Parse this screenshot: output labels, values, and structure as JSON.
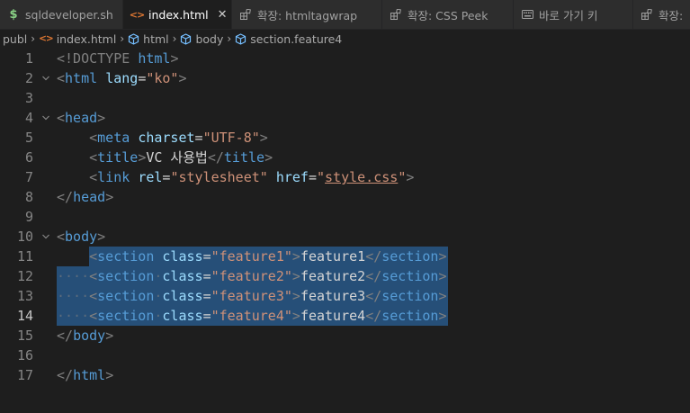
{
  "tabs": [
    {
      "label": "sqldeveloper.sh",
      "icon": "dollar-icon",
      "active": false
    },
    {
      "label": "index.html",
      "icon": "html-file-icon",
      "active": true,
      "close": "✕"
    },
    {
      "label": "확장: htmltagwrap",
      "icon": "extension-icon",
      "active": false
    },
    {
      "label": "확장: CSS Peek",
      "icon": "extension-icon",
      "active": false
    },
    {
      "label": "바로 가기 키",
      "icon": "keyboard-icon",
      "active": false
    },
    {
      "label": "확장:",
      "icon": "extension-icon",
      "active": false
    }
  ],
  "breadcrumb": {
    "items": [
      "publ",
      "index.html",
      "html",
      "body",
      "section.feature4"
    ]
  },
  "editor": {
    "current_line": 14,
    "selected_lines": [
      11,
      12,
      13,
      14
    ],
    "lines": [
      {
        "n": "1",
        "text": "<!DOCTYPE html>"
      },
      {
        "n": "2",
        "text": "<html lang=\"ko\">"
      },
      {
        "n": "3",
        "text": ""
      },
      {
        "n": "4",
        "text": "<head>"
      },
      {
        "n": "5",
        "text": "    <meta charset=\"UTF-8\">"
      },
      {
        "n": "6",
        "text": "    <title>VC 사용법</title>"
      },
      {
        "n": "7",
        "text": "    <link rel=\"stylesheet\" href=\"style.css\">"
      },
      {
        "n": "8",
        "text": "</head>"
      },
      {
        "n": "9",
        "text": ""
      },
      {
        "n": "10",
        "text": "<body>"
      },
      {
        "n": "11",
        "text": "    <section class=\"feature1\">feature1</section>"
      },
      {
        "n": "12",
        "text": "    <section class=\"feature2\">feature2</section>"
      },
      {
        "n": "13",
        "text": "    <section class=\"feature3\">feature3</section>"
      },
      {
        "n": "14",
        "text": "    <section class=\"feature4\">feature4</section>"
      },
      {
        "n": "15",
        "text": "</body>"
      },
      {
        "n": "16",
        "text": ""
      },
      {
        "n": "17",
        "text": "</html>"
      }
    ]
  },
  "colors": {
    "background": "#1e1e1e",
    "tag": "#569cd6",
    "attribute": "#9cdcfe",
    "string": "#ce9178",
    "selection": "#264f78"
  }
}
